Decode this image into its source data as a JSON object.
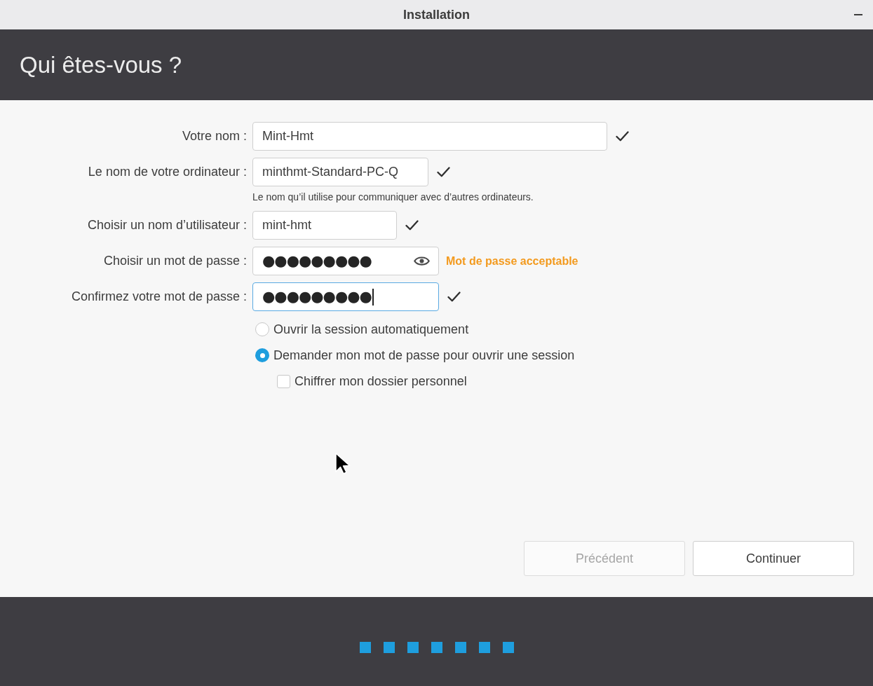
{
  "window": {
    "title": "Installation"
  },
  "header": {
    "title": "Qui êtes-vous ?"
  },
  "form": {
    "fields": [
      {
        "label": "Votre nom :",
        "value": "Mint-Hmt",
        "valid": true,
        "focused": false,
        "reveal": false
      },
      {
        "label": "Le nom de votre ordinateur :",
        "value": "minthmt-Standard-PC-Q",
        "hint": "Le nom qu’il utilise pour communiquer avec d’autres ordinateurs.",
        "valid": true,
        "focused": false,
        "reveal": false
      },
      {
        "label": "Choisir un nom d’utilisateur :",
        "value": "mint-hmt",
        "valid": true,
        "focused": false,
        "reveal": false
      },
      {
        "label": "Choisir un mot de passe :",
        "value": "●●●●●●●●●",
        "strength": "Mot de passe acceptable",
        "valid": false,
        "focused": false,
        "reveal": true
      },
      {
        "label": "Confirmez votre mot de passe :",
        "value": "●●●●●●●●●",
        "valid": true,
        "focused": true,
        "reveal": false
      }
    ]
  },
  "login": {
    "options": [
      {
        "label": "Ouvrir la session automatiquement",
        "selected": false
      },
      {
        "label": "Demander mon mot de passe pour ouvrir une session",
        "selected": true
      }
    ],
    "encrypt": {
      "label": "Chiffrer mon dossier personnel",
      "checked": false
    }
  },
  "buttons": [
    {
      "label": "Précédent",
      "disabled": true
    },
    {
      "label": "Continuer",
      "disabled": false
    }
  ],
  "progress": {
    "steps": [
      {
        "done": true
      },
      {
        "done": true
      },
      {
        "done": true
      },
      {
        "done": true
      },
      {
        "done": true
      },
      {
        "done": true
      },
      {
        "done": true
      }
    ]
  }
}
